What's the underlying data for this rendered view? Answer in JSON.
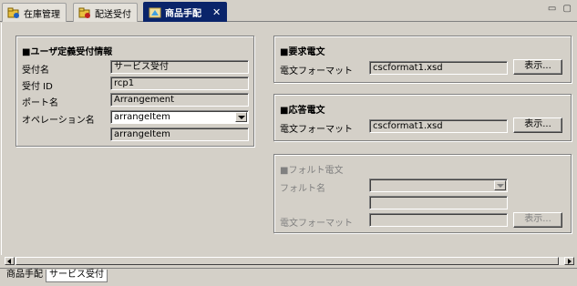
{
  "tabs": [
    {
      "label": "在庫管理",
      "icon": "stock-folder-icon"
    },
    {
      "label": "配送受付",
      "icon": "delivery-folder-icon"
    },
    {
      "label": "商品手配",
      "icon": "product-icon",
      "close": "✕"
    }
  ],
  "window_controls": "▭ ▢",
  "user_group": {
    "title": "■ユーザ定義受付情報",
    "rows": [
      {
        "label": "受付名",
        "value": "サービス受付"
      },
      {
        "label": "受付 ID",
        "value": "rcp1"
      },
      {
        "label": "ポート名",
        "value": "Arrangement"
      },
      {
        "label": "オペレーション名",
        "value": "arrangeItem"
      }
    ],
    "operation_echo": "arrangeItem"
  },
  "request_group": {
    "title": "■要求電文",
    "format_label": "電文フォーマット",
    "format_value": "cscformat1.xsd",
    "browse": "表示..."
  },
  "response_group": {
    "title": "■応答電文",
    "format_label": "電文フォーマット",
    "format_value": "cscformat1.xsd",
    "browse": "表示..."
  },
  "fault_group": {
    "title": "■フォルト電文",
    "fault_label": "フォルト名",
    "fault_value": "",
    "extra_value": "",
    "format_label": "電文フォーマット",
    "format_value": "",
    "browse": "表示..."
  },
  "bottom_tabs": [
    {
      "label": "商品手配"
    },
    {
      "label": "サービス受付"
    }
  ]
}
